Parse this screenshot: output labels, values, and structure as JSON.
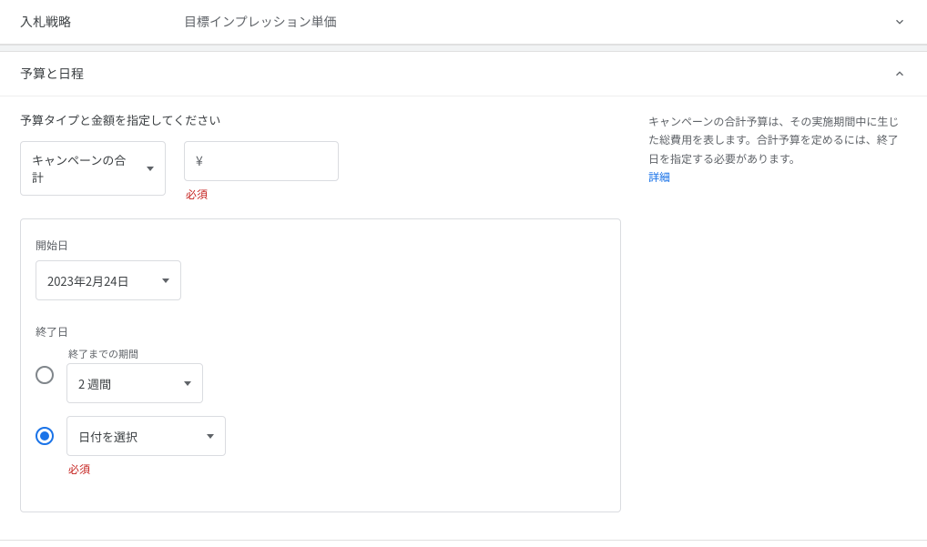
{
  "panels": {
    "bidding": {
      "title": "入札戦略",
      "value": "目標インプレッション単価"
    },
    "budget": {
      "title": "予算と日程",
      "section_label": "予算タイプと金額を指定してください",
      "type_select": {
        "label": "キャンペーンの合計"
      },
      "amount": {
        "currency": "¥",
        "value": "",
        "error": "必須"
      },
      "start": {
        "label": "開始日",
        "value": "2023年2月24日"
      },
      "end": {
        "label": "終了日",
        "duration_float_label": "終了までの期間",
        "duration_value": "2 週間",
        "date_value": "日付を選択",
        "date_error": "必須"
      }
    }
  },
  "help": {
    "text": "キャンペーンの合計予算は、その実施期間中に生じた総費用を表します。合計予算を定めるには、終了日を指定する必要があります。",
    "link": "詳細"
  }
}
